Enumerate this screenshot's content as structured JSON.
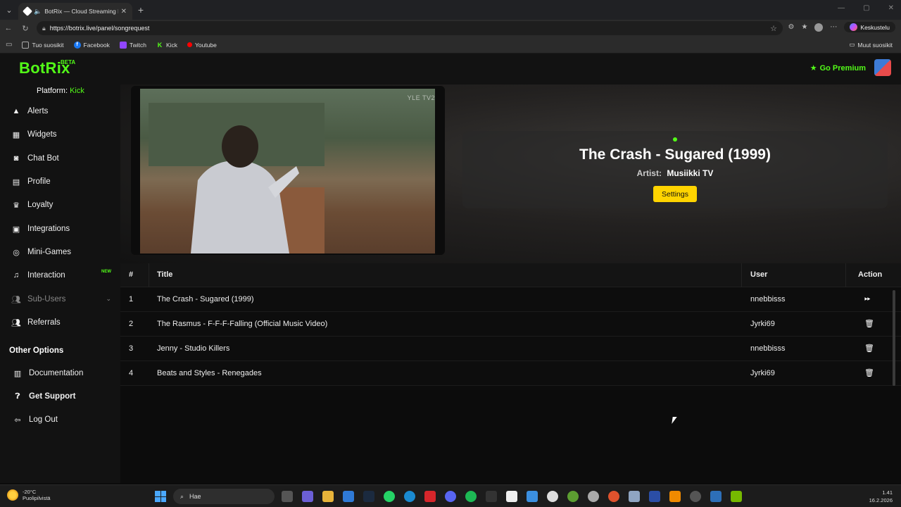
{
  "browser": {
    "tab_title": "BotRix — Cloud Streaming Bot",
    "url": "https://botrix.live/panel/songrequest",
    "copilot_label": "Keskustelu",
    "bookmarks": [
      {
        "label": "Tuo suosikit",
        "color": "#555555",
        "icon": "import-icon"
      },
      {
        "label": "Facebook",
        "color": "#1877f2",
        "icon": "facebook-icon"
      },
      {
        "label": "Twitch",
        "color": "#9146ff",
        "icon": "twitch-icon"
      },
      {
        "label": "Kick",
        "color": "#53fc18",
        "icon": "kick-icon"
      },
      {
        "label": "Youtube",
        "color": "#ff0000",
        "icon": "youtube-icon"
      }
    ],
    "other_bookmarks": "Muut suosikit"
  },
  "app": {
    "logo": "BotRix",
    "logo_badge": "BETA",
    "premium": "Go Premium",
    "accent": "#53fc18"
  },
  "sidebar": {
    "platform_label": "Platform:",
    "platform_value": "Kick",
    "items": [
      {
        "label": "Alerts",
        "icon": "warning-icon"
      },
      {
        "label": "Widgets",
        "icon": "widgets-icon"
      },
      {
        "label": "Chat Bot",
        "icon": "robot-icon"
      },
      {
        "label": "Profile",
        "icon": "profile-card-icon"
      },
      {
        "label": "Loyalty",
        "icon": "trophy-icon"
      },
      {
        "label": "Integrations",
        "icon": "integrations-icon"
      },
      {
        "label": "Mini-Games",
        "icon": "gamepad-icon"
      },
      {
        "label": "Interaction",
        "icon": "music-icon",
        "badge": "NEW"
      },
      {
        "label": "Sub-Users",
        "icon": "users-icon"
      },
      {
        "label": "Referrals",
        "icon": "referrals-icon"
      }
    ],
    "other_options_title": "Other Options",
    "other_items": [
      {
        "label": "Documentation",
        "icon": "book-icon"
      },
      {
        "label": "Get Support",
        "icon": "question-icon"
      },
      {
        "label": "Log Out",
        "icon": "logout-icon"
      }
    ]
  },
  "now_playing": {
    "video_watermark": "YLE TV2",
    "title": "The Crash - Sugared (1999)",
    "artist_label": "Artist:",
    "artist": "Musiikki TV",
    "settings_button": "Settings"
  },
  "queue": {
    "headers": {
      "num": "#",
      "title": "Title",
      "user": "User",
      "action": "Action"
    },
    "rows": [
      {
        "num": "1",
        "title": "The Crash - Sugared (1999)",
        "user": "nnebbisss",
        "action": "skip-icon"
      },
      {
        "num": "2",
        "title": "The Rasmus - F-F-F-Falling (Official Music Video)",
        "user": "Jyrki69",
        "action": "trash-icon"
      },
      {
        "num": "3",
        "title": "Jenny - Studio Killers",
        "user": "nnebbisss",
        "action": "trash-icon"
      },
      {
        "num": "4",
        "title": "Beats and Styles - Renegades",
        "user": "Jyrki69",
        "action": "trash-icon"
      }
    ]
  },
  "taskbar": {
    "weather_temp": "-20°C",
    "weather_desc": "Puolipilvistä",
    "search_placeholder": "Hae",
    "time": "1.41",
    "date": "16.2.2026"
  }
}
